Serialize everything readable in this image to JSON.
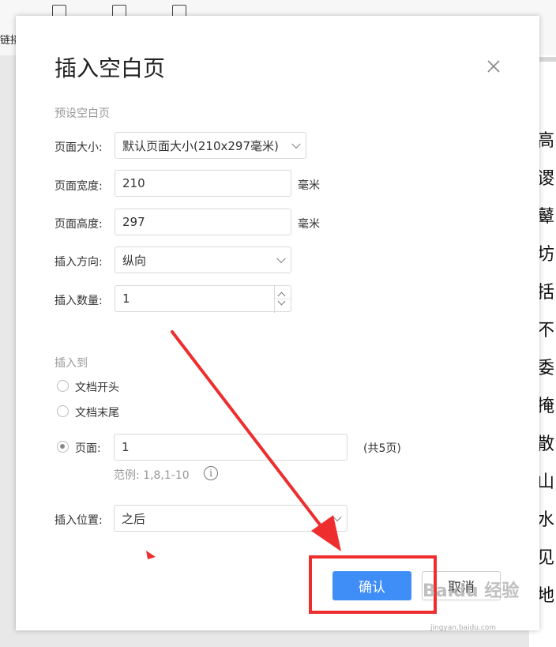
{
  "background_toolbar": {
    "link_label": "链接"
  },
  "background_doc": {
    "chars": [
      "高",
      "谡",
      "鼙",
      "坊",
      "括",
      "不",
      "委",
      "掩",
      "散",
      "山",
      "水",
      "见",
      "地"
    ]
  },
  "dialog": {
    "title": "插入空白页",
    "preset": {
      "section_label": "预设空白页",
      "page_size_label": "页面大小:",
      "page_size_value": "默认页面大小(210x297毫米)",
      "page_width_label": "页面宽度:",
      "page_width_value": "210",
      "page_width_unit": "毫米",
      "page_height_label": "页面高度:",
      "page_height_value": "297",
      "page_height_unit": "毫米",
      "orientation_label": "插入方向:",
      "orientation_value": "纵向",
      "count_label": "插入数量:",
      "count_value": "1"
    },
    "insert_to": {
      "section_label": "插入到",
      "option_start": "文档开头",
      "option_end": "文档末尾",
      "option_page": "页面:",
      "page_value": "1",
      "page_total": "(共5页)",
      "example": "范例: 1,8,1-10",
      "selected": "page"
    },
    "position": {
      "label": "插入位置:",
      "value": "之后"
    },
    "buttons": {
      "confirm": "确认",
      "cancel": "取消"
    }
  },
  "annotation": {
    "color": "#ee2e2e"
  },
  "watermark": {
    "text": "Baidu 经验",
    "sub": "jingyan.baidu.com"
  },
  "colors": {
    "primary": "#3f8ef7"
  }
}
